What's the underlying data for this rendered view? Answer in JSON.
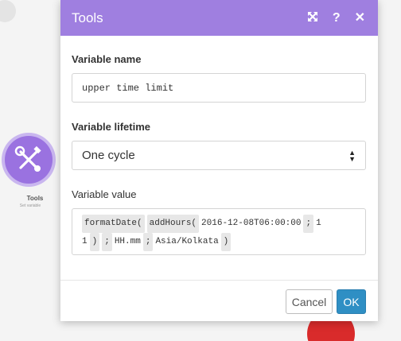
{
  "dialog": {
    "title": "Tools",
    "header_icons": [
      "expand-icon",
      "help-icon",
      "close-icon"
    ]
  },
  "fields": {
    "variable_name": {
      "label": "Variable name",
      "value": "upper time limit"
    },
    "variable_lifetime": {
      "label": "Variable lifetime",
      "selected": "One cycle"
    },
    "variable_value": {
      "label": "Variable value",
      "line1": [
        {
          "text": "formatDate(",
          "pill": true
        },
        {
          "text": "addHours(",
          "pill": true
        },
        {
          "text": "2016-12-08T06:00:00",
          "pill": false
        },
        {
          "text": ";",
          "pill": true
        },
        {
          "text": "1",
          "pill": false
        }
      ],
      "line2": [
        {
          "text": "1",
          "pill": false
        },
        {
          "text": ")",
          "pill": true
        },
        {
          "text": ";",
          "pill": true
        },
        {
          "text": "HH.mm",
          "pill": false
        },
        {
          "text": ";",
          "pill": true
        },
        {
          "text": "Asia/Kolkata",
          "pill": false
        },
        {
          "text": ")",
          "pill": true
        }
      ]
    }
  },
  "buttons": {
    "cancel": "Cancel",
    "ok": "OK"
  },
  "module": {
    "label": "Tools",
    "sublabel": "Set variable",
    "colors": {
      "core": "#9a72e0",
      "ring": "#c9b6ef"
    }
  },
  "colors": {
    "header": "#9f7fe0",
    "ok_button": "#2f8fc4",
    "red_node": "#d92b2b"
  }
}
